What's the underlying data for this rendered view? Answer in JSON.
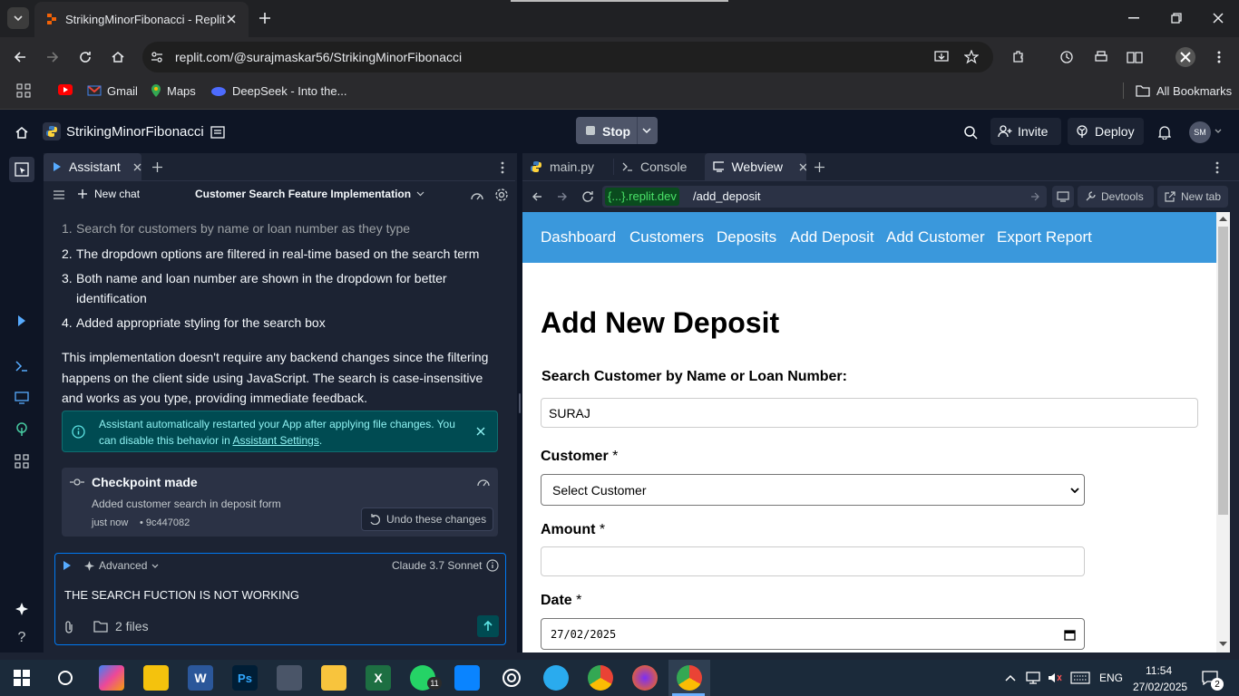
{
  "browser": {
    "tab_title": "StrikingMinorFibonacci - Replit",
    "url": "replit.com/@surajmaskar56/StrikingMinorFibonacci",
    "bookmarks": [
      "Gmail",
      "Maps",
      "DeepSeek - Into the..."
    ],
    "all_bookmarks": "All Bookmarks"
  },
  "replit": {
    "project_name": "StrikingMinorFibonacci",
    "stop_label": "Stop",
    "invite_label": "Invite",
    "deploy_label": "Deploy",
    "avatar_initials": "SM"
  },
  "assistant": {
    "tab_label": "Assistant",
    "new_chat": "New chat",
    "chat_title": "Customer Search Feature Implementation",
    "list_items": [
      {
        "num": "1.",
        "text": "Search for customers by name or loan number as they type"
      },
      {
        "num": "2.",
        "text": "The dropdown options are filtered in real-time based on the search term"
      },
      {
        "num": "3.",
        "text": "Both name and loan number are shown in the dropdown for better"
      },
      {
        "num": "",
        "text": "identification"
      },
      {
        "num": "4.",
        "text": "Added appropriate styling for the search box"
      }
    ],
    "paragraph": "This implementation doesn't require any backend changes since the filtering happens on the client side using JavaScript. The search is case-insensitive and works as you type, providing immediate feedback.",
    "notice_text": "Assistant automatically restarted your App after applying file changes. You can disable this behavior in",
    "notice_link": "Assistant Settings",
    "notice_end": ".",
    "checkpoint_title": "Checkpoint made",
    "checkpoint_desc": "Added customer search in deposit form",
    "checkpoint_time": "just now",
    "checkpoint_hash": "• 9c447082",
    "undo_label": "Undo these changes",
    "mode_label": "Advanced",
    "model_label": "Claude 3.7 Sonnet",
    "input_value": "THE SEARCH FUCTION IS NOT WORKING",
    "files_label": "2 files"
  },
  "editor_tabs": [
    {
      "label": "main.py"
    },
    {
      "label": "Console"
    },
    {
      "label": "Webview"
    }
  ],
  "webview_bar": {
    "domain": "{...}.replit.dev",
    "path": "/add_deposit",
    "devtools": "Devtools",
    "new_tab": "New tab"
  },
  "webpage": {
    "nav": [
      "Dashboard",
      "Customers",
      "Deposits",
      "Add Deposit",
      "Add Customer",
      "Export Report"
    ],
    "heading": "Add New Deposit",
    "search_label": "Search Customer by Name or Loan Number:",
    "search_value": "SURAJ",
    "customer_label": "Customer",
    "customer_select": "Select Customer",
    "amount_label": "Amount",
    "date_label": "Date",
    "date_value": "27/02/2025",
    "required_mark": "*"
  },
  "taskbar": {
    "lang": "ENG",
    "time": "11:54",
    "date": "27/02/2025",
    "whatsapp_badge": "11",
    "notif_count": "2"
  }
}
